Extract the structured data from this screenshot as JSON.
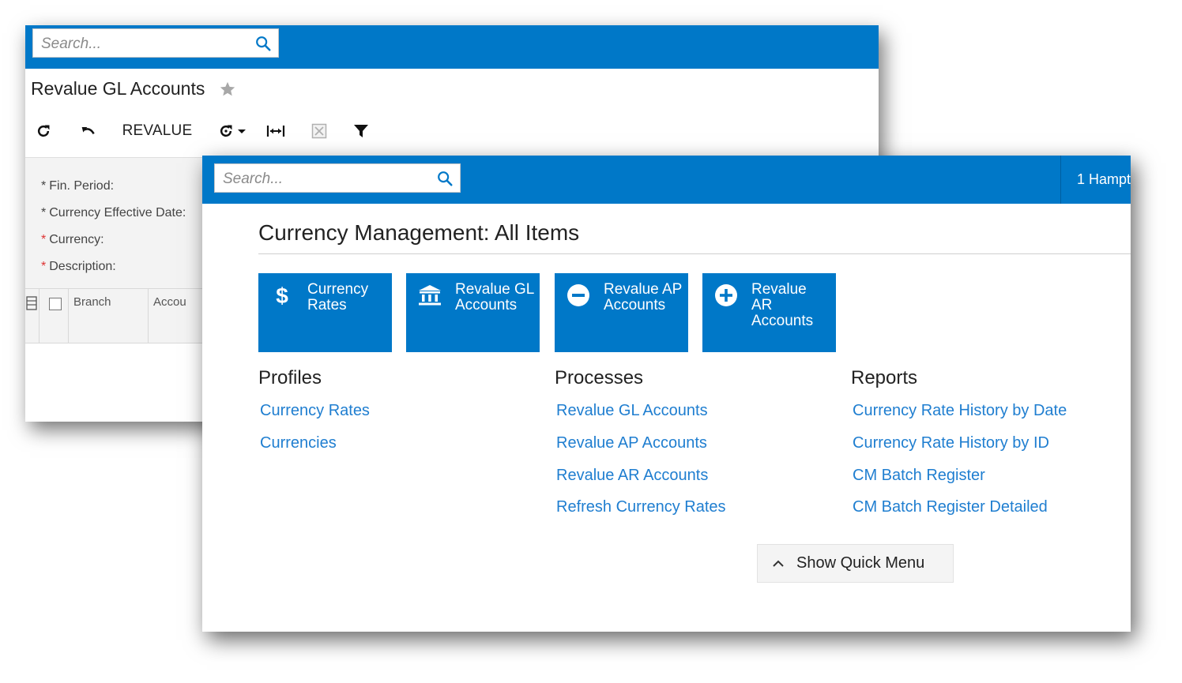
{
  "back_window": {
    "search": {
      "placeholder": "Search..."
    },
    "page_title": "Revalue GL Accounts",
    "toolbar": {
      "revalue_label": "REVALUE"
    },
    "form": {
      "fin_period_label": "Fin. Period:",
      "currency_effective_date_label": "Currency Effective Date:",
      "currency_label": "Currency:",
      "description_label": "Description:"
    },
    "grid": {
      "columns": [
        "Branch",
        "Accou"
      ]
    }
  },
  "front_window": {
    "search": {
      "placeholder": "Search..."
    },
    "tenant": "1 Hampt",
    "title": "Currency Management: All Items",
    "tiles": [
      {
        "label": "Currency Rates",
        "icon": "dollar-icon"
      },
      {
        "label": "Revalue GL Accounts",
        "icon": "bank-icon"
      },
      {
        "label": "Revalue AP Accounts",
        "icon": "minus-circle-icon"
      },
      {
        "label": "Revalue AR Accounts",
        "icon": "plus-circle-icon"
      }
    ],
    "sections": {
      "profiles": {
        "heading": "Profiles",
        "links": [
          "Currency Rates",
          "Currencies"
        ]
      },
      "processes": {
        "heading": "Processes",
        "links": [
          "Revalue GL Accounts",
          "Revalue AP Accounts",
          "Revalue AR Accounts",
          "Refresh Currency Rates"
        ]
      },
      "reports": {
        "heading": "Reports",
        "links": [
          "Currency Rate History by Date",
          "Currency Rate History by ID",
          "CM Batch Register",
          "CM Batch Register Detailed"
        ]
      }
    },
    "quick_menu_label": "Show Quick Menu"
  },
  "colors": {
    "accent": "#0078c8",
    "link": "#1f7ed0",
    "required": "#d33333"
  }
}
